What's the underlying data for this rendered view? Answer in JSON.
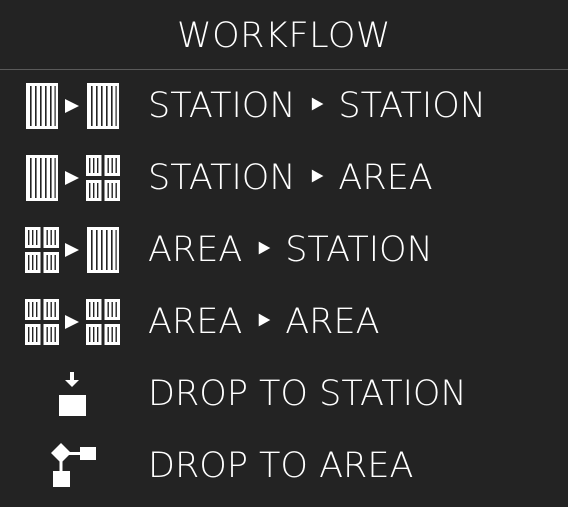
{
  "menu": {
    "title": "WORKFLOW",
    "items": [
      {
        "label": "STATION ‣ STATION",
        "icon": "station-to-station-icon"
      },
      {
        "label": "STATION ‣ AREA",
        "icon": "station-to-area-icon"
      },
      {
        "label": "AREA ‣ STATION",
        "icon": "area-to-station-icon"
      },
      {
        "label": "AREA ‣ AREA",
        "icon": "area-to-area-icon"
      },
      {
        "label": "DROP TO STATION",
        "icon": "drop-to-station-icon"
      },
      {
        "label": "DROP TO AREA",
        "icon": "drop-to-area-icon"
      }
    ]
  },
  "colors": {
    "background": "#232323",
    "text": "#ffffff",
    "divider": "#5a5a5a"
  }
}
